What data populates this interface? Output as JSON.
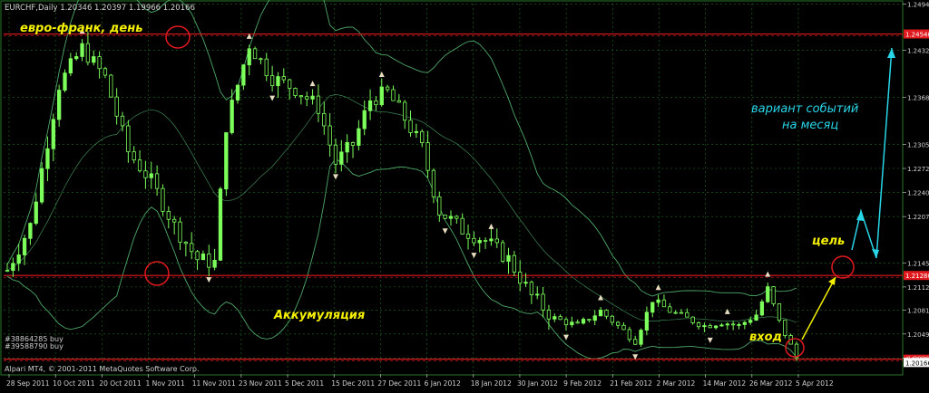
{
  "window": {
    "header": "EURCHF,Daily  1.20346 1.20397 1.19966 1.20166",
    "copyright": "Alpari MT4, © 2001-2011 MetaQuotes Software Corp."
  },
  "colors": {
    "background": "#000000",
    "grid": "#1f6f1f",
    "candle": "#7cff5a",
    "band": "#4fa86a",
    "annotation_yellow": "#f4f000",
    "annotation_cyan": "#28d6e8",
    "level_red": "#e0191e",
    "fractal": "#e8dcc0"
  },
  "annotations": {
    "title": "евро-франк, день",
    "accumulation": "Аккумуляция",
    "scenario_line1": "вариант событий",
    "scenario_line2": "на месяц",
    "target": "цель",
    "entry": "вход",
    "order1": "#38864285 buy",
    "order2": "#39588790 buy"
  },
  "chart_data": {
    "type": "candlestick",
    "symbol": "EURCHF",
    "timeframe": "Daily",
    "ohlc_header": {
      "open": 1.20346,
      "high": 1.20397,
      "low": 1.19966,
      "close": 1.20166
    },
    "ylim": [
      1.1995,
      1.2495
    ],
    "y_ticks": [
      "1.24945",
      "1.24320",
      "1.23685",
      "1.23050",
      "1.22725",
      "1.22400",
      "1.22075",
      "1.21450",
      "1.21125",
      "1.20810",
      "1.20490",
      "1.20166"
    ],
    "y_tick_values": [
      1.24945,
      1.2432,
      1.23685,
      1.2305,
      1.22725,
      1.224,
      1.22075,
      1.2145,
      1.21125,
      1.2081,
      1.2049,
      1.20166
    ],
    "x_labels": [
      "28 Sep 2011",
      "10 Oct 2011",
      "20 Oct 2011",
      "1 Nov 2011",
      "11 Nov 2011",
      "23 Nov 2011",
      "5 Dec 2011",
      "15 Dec 2011",
      "27 Dec 2011",
      "6 Jan 2012",
      "18 Jan 2012",
      "30 Jan 2012",
      "9 Feb 2012",
      "21 Feb 2012",
      "2 Mar 2012",
      "14 Mar 2012",
      "26 Mar 2012",
      "5 Apr 2012"
    ],
    "levels": [
      {
        "name": "resistance",
        "value": 1.2454,
        "label": "1.24540"
      },
      {
        "name": "target",
        "value": 1.2128,
        "label": "1.21280"
      },
      {
        "name": "entry",
        "value": 1.2015,
        "label": "1.20150"
      }
    ],
    "current_price_label": "1.20166",
    "num_bars": 138
  }
}
